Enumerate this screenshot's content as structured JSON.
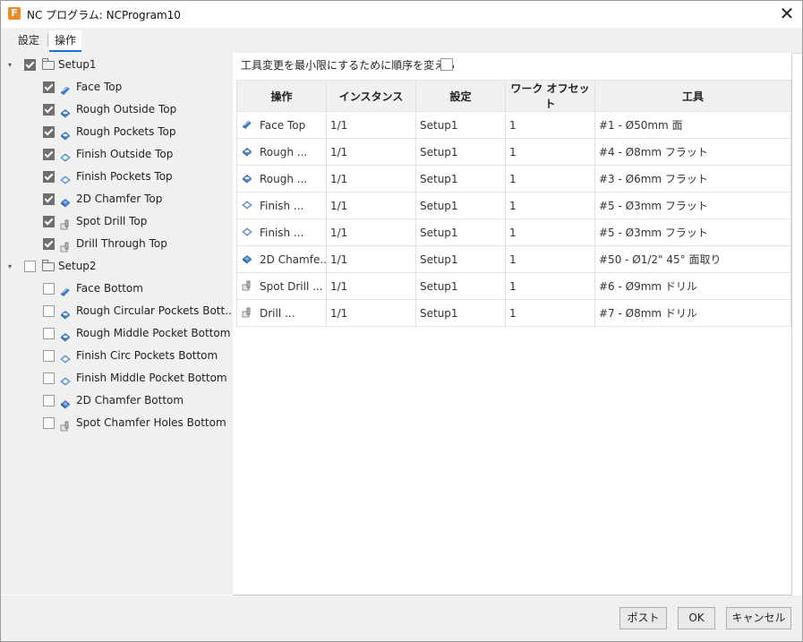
{
  "window": {
    "title": "NC プログラム: NCProgram10",
    "app_icon_letter": "F"
  },
  "tabs": [
    {
      "label": "設定"
    },
    {
      "label": "操作"
    }
  ],
  "tree": {
    "setups": [
      {
        "label": "Setup1",
        "checked": true,
        "operations": [
          {
            "label": "Face Top",
            "checked": true,
            "icon": "face-op-icon"
          },
          {
            "label": "Rough Outside Top",
            "checked": true,
            "icon": "adaptive-op-icon"
          },
          {
            "label": "Rough Pockets Top",
            "checked": true,
            "icon": "adaptive-op-icon"
          },
          {
            "label": "Finish Outside Top",
            "checked": true,
            "icon": "contour-op-icon"
          },
          {
            "label": "Finish Pockets Top",
            "checked": true,
            "icon": "contour-op-icon"
          },
          {
            "label": "2D Chamfer Top",
            "checked": true,
            "icon": "chamfer-op-icon"
          },
          {
            "label": "Spot Drill Top",
            "checked": true,
            "icon": "drill-op-icon"
          },
          {
            "label": "Drill Through Top",
            "checked": true,
            "icon": "drill-op-icon"
          }
        ]
      },
      {
        "label": "Setup2",
        "checked": false,
        "operations": [
          {
            "label": "Face Bottom",
            "checked": false,
            "icon": "face-op-icon"
          },
          {
            "label": "Rough Circular Pockets Bott...",
            "checked": false,
            "icon": "adaptive-op-icon"
          },
          {
            "label": "Rough Middle Pocket Bottom",
            "checked": false,
            "icon": "adaptive-op-icon"
          },
          {
            "label": "Finish Circ Pockets Bottom",
            "checked": false,
            "icon": "contour-op-icon"
          },
          {
            "label": "Finish Middle Pocket Bottom",
            "checked": false,
            "icon": "contour-op-icon"
          },
          {
            "label": "2D Chamfer Bottom",
            "checked": false,
            "icon": "chamfer-op-icon"
          },
          {
            "label": "Spot Chamfer Holes Bottom",
            "checked": false,
            "icon": "drill-op-icon"
          }
        ]
      }
    ]
  },
  "reorder": {
    "label": "工具変更を最小限にするために順序を変える",
    "checked": false
  },
  "table": {
    "headers": [
      "操作",
      "インスタンス",
      "設定",
      "ワーク オフセット",
      "工具"
    ],
    "rows": [
      {
        "op": "Face Top",
        "icon": "face-op-icon",
        "instance": "1/1",
        "setup": "Setup1",
        "offset": "1",
        "tool": "#1 - Ø50mm 面"
      },
      {
        "op": "Rough ...",
        "icon": "adaptive-op-icon",
        "instance": "1/1",
        "setup": "Setup1",
        "offset": "1",
        "tool": "#4 - Ø8mm フラット"
      },
      {
        "op": "Rough ...",
        "icon": "adaptive-op-icon",
        "instance": "1/1",
        "setup": "Setup1",
        "offset": "1",
        "tool": "#3 - Ø6mm フラット"
      },
      {
        "op": "Finish ...",
        "icon": "contour-op-icon",
        "instance": "1/1",
        "setup": "Setup1",
        "offset": "1",
        "tool": "#5 - Ø3mm フラット"
      },
      {
        "op": "Finish ...",
        "icon": "contour-op-icon",
        "instance": "1/1",
        "setup": "Setup1",
        "offset": "1",
        "tool": "#5 - Ø3mm フラット"
      },
      {
        "op": "2D Chamfe...",
        "icon": "chamfer-op-icon",
        "instance": "1/1",
        "setup": "Setup1",
        "offset": "1",
        "tool": "#50 - Ø1/2\" 45° 面取り"
      },
      {
        "op": "Spot Drill ...",
        "icon": "drill-op-icon",
        "instance": "1/1",
        "setup": "Setup1",
        "offset": "1",
        "tool": "#6 - Ø9mm ドリル"
      },
      {
        "op": "Drill ...",
        "icon": "drill-op-icon",
        "instance": "1/1",
        "setup": "Setup1",
        "offset": "1",
        "tool": "#7 - Ø8mm ドリル"
      }
    ]
  },
  "buttons": {
    "post": "ポスト",
    "ok": "OK",
    "cancel": "キャンセル"
  },
  "colors": {
    "accent": "#1a73d9",
    "op_icon_blue": "#3b79c4",
    "op_icon_light": "#8fb8e6",
    "panel_bg": "#f0f0f0"
  }
}
